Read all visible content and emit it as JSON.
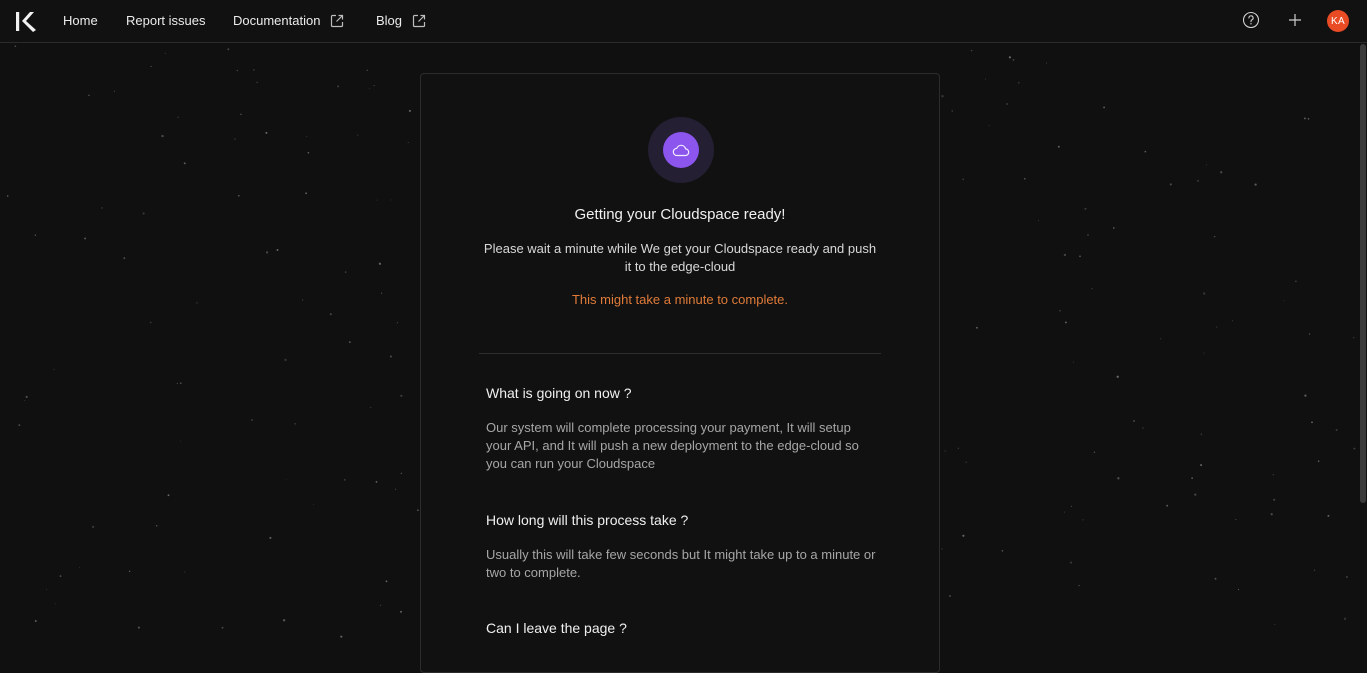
{
  "nav": {
    "logo": "lightning-logo",
    "items": [
      {
        "label": "Home",
        "external": false
      },
      {
        "label": "Report issues",
        "external": false
      },
      {
        "label": "Documentation",
        "external": true
      },
      {
        "label": "Blog",
        "external": true
      }
    ],
    "help_icon": "help-circle-icon",
    "add_icon": "plus-icon",
    "avatar_initials": "KA",
    "avatar_color": "#e94b24"
  },
  "card": {
    "icon": "cloud-icon",
    "icon_color": "#8b55ee",
    "title": "Getting your Cloudspace ready!",
    "description": "Please wait a minute while We get your Cloudspace ready and push it to the edge-cloud",
    "warning": "This might take a minute to complete.",
    "warning_color": "#e07b39",
    "faq": [
      {
        "question": "What is going on now ?",
        "answer": "Our system will complete processing your payment, It will setup your API, and It will push a new deployment to the edge-cloud so you can run your Cloudspace"
      },
      {
        "question": "How long will this process take ?",
        "answer": "Usually this will take few seconds but It might take up to a minute or two to complete."
      },
      {
        "question": "Can I leave the page ?",
        "answer": ""
      }
    ]
  }
}
